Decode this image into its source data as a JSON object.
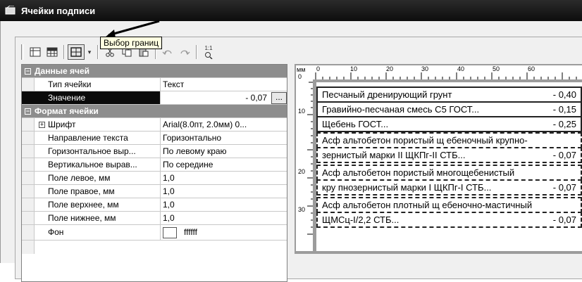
{
  "window": {
    "title": "Ячейки подписи"
  },
  "toolbar": {
    "tooltip": "Выбор границ",
    "zoom_label": "1:1",
    "buttons": [
      "table-icon",
      "grid-icon",
      "borders-icon",
      "cut-icon",
      "copy-icon",
      "paste-icon",
      "undo-icon",
      "redo-icon",
      "zoom-icon"
    ]
  },
  "properties": {
    "cat_data": "Данные ячей",
    "cat_format": "Формат ячейки",
    "rows_data": [
      {
        "name": "Тип ячейки",
        "value": "Текст"
      },
      {
        "name": "Значение",
        "value": "- 0,07"
      }
    ],
    "ellipsis": "...",
    "rows_format": [
      {
        "name": "Шрифт",
        "value": "Arial(8.0пт, 2.0мм) 0..."
      },
      {
        "name": "Направление текста",
        "value": "Горизонтально"
      },
      {
        "name": "Горизонтальное выр...",
        "value": "По левому краю"
      },
      {
        "name": "Вертикальное вырав...",
        "value": "По середине"
      },
      {
        "name": "Поле левое, мм",
        "value": "1,0"
      },
      {
        "name": "Поле правое, мм",
        "value": "1,0"
      },
      {
        "name": "Поле верхнее, мм",
        "value": "1,0"
      },
      {
        "name": "Поле нижнее, мм",
        "value": "1,0"
      },
      {
        "name": "Фон",
        "value": "ffffff"
      }
    ]
  },
  "preview": {
    "ruler_unit": "мм",
    "ruler_zero": "0",
    "ruler_top": [
      "0",
      "10",
      "20",
      "30",
      "40",
      "50",
      "60"
    ],
    "ruler_left": [
      "10",
      "20",
      "30"
    ],
    "cells": [
      {
        "text": "Песчаный дренирующий грунт",
        "value": "- 0,40"
      },
      {
        "text": "Гравийно-песчаная смесь С5 ГОСТ...",
        "value": "- 0,15"
      },
      {
        "text": "Щебень ГОСТ...",
        "value": "- 0,25"
      },
      {
        "text": "Асф альтобетон пористый щ ебеночный крупно-",
        "value": ""
      },
      {
        "text": "зернистый марки II ЩКПг-II СТБ...",
        "value": "- 0,07"
      },
      {
        "text": "Асф альтобетон пористый многощебенистый",
        "value": ""
      },
      {
        "text": "кру пнозернистый марки I ЩКПг-I СТБ...",
        "value": "- 0,07"
      },
      {
        "text": "Асф альтобетон плотный щ ебеночно-мастичный",
        "value": ""
      },
      {
        "text": "ЩМСц-I/2,2 СТБ...",
        "value": "- 0,07"
      }
    ]
  }
}
